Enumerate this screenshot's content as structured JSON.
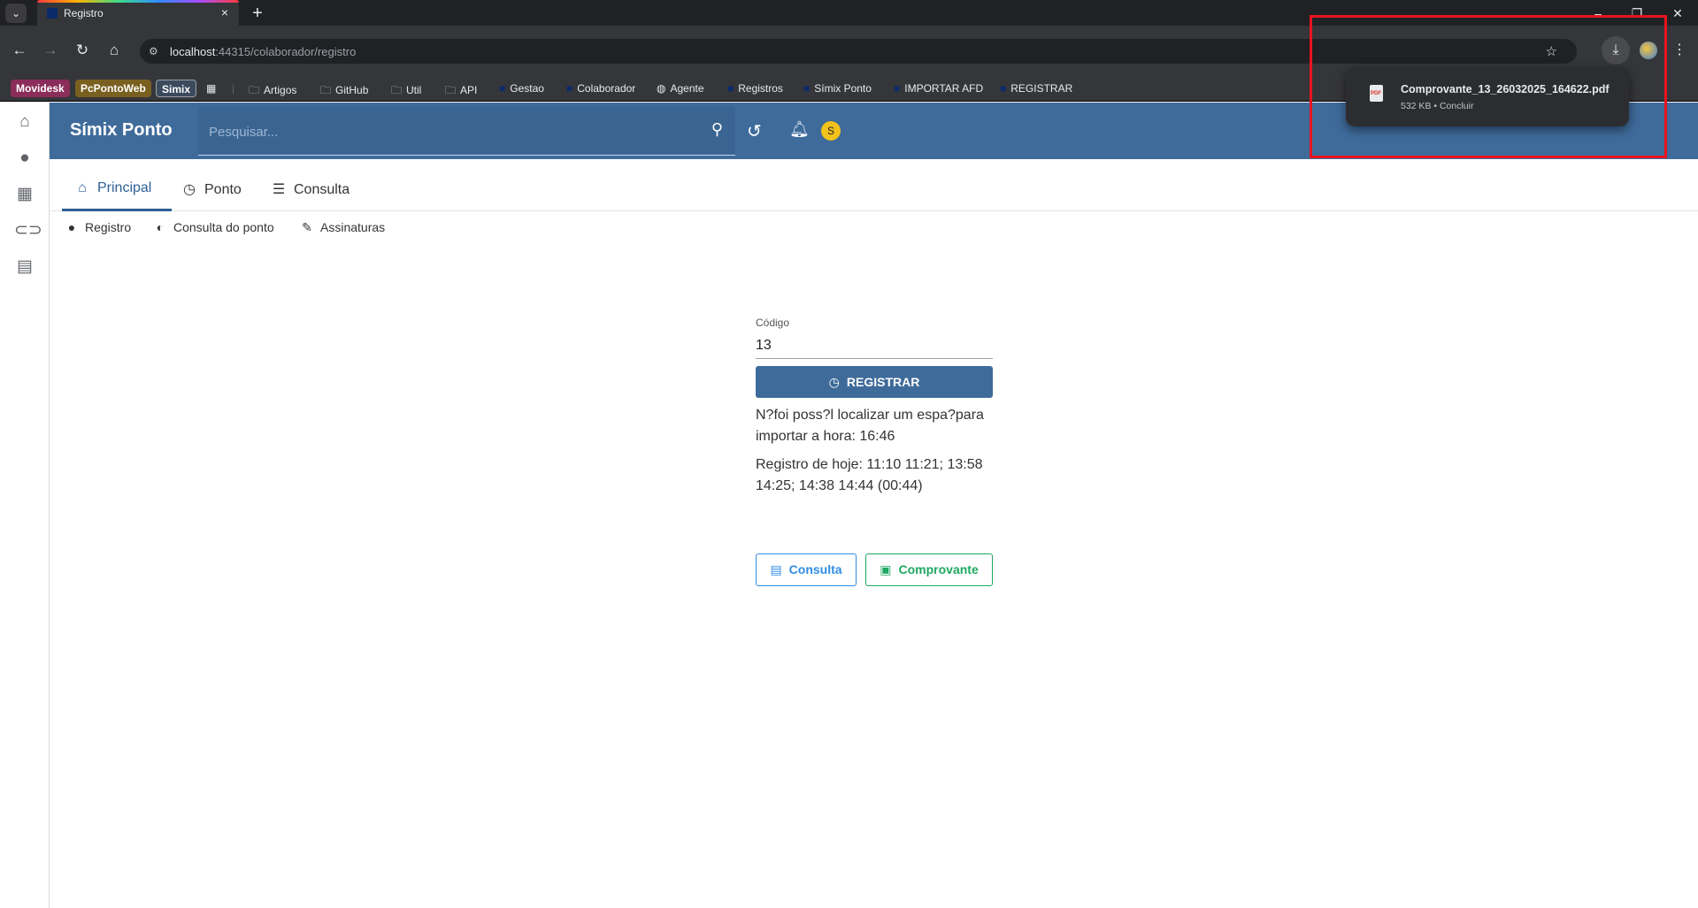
{
  "browser": {
    "tab_title": "Registro",
    "url_host": "localhost",
    "url_path": ":44315/colaborador/registro",
    "bookmarks": [
      {
        "label": "Movidesk",
        "kind": "chip",
        "color": "#c2185b"
      },
      {
        "label": "PcPontoWeb",
        "kind": "chip",
        "color": "#b8860b"
      },
      {
        "label": "Simix",
        "kind": "chip",
        "color": "#3c4a5e"
      },
      {
        "label": "Artigos",
        "kind": "folder"
      },
      {
        "label": "GitHub",
        "kind": "folder"
      },
      {
        "label": "Util",
        "kind": "folder"
      },
      {
        "label": "API",
        "kind": "folder"
      },
      {
        "label": "Gestao",
        "kind": "link"
      },
      {
        "label": "Colaborador",
        "kind": "link"
      },
      {
        "label": "Agente",
        "kind": "link"
      },
      {
        "label": "Registros",
        "kind": "link"
      },
      {
        "label": "Símix Ponto",
        "kind": "link"
      },
      {
        "label": "IMPORTAR AFD",
        "kind": "link"
      },
      {
        "label": "REGISTRAR",
        "kind": "link"
      }
    ]
  },
  "download": {
    "filename": "Comprovante_13_26032025_164622.pdf",
    "status": "532 KB • Concluir"
  },
  "app": {
    "title": "Símix Ponto",
    "search_placeholder": "Pesquisar...",
    "avatar_letter": "S"
  },
  "tabs": {
    "principal": "Principal",
    "ponto": "Ponto",
    "consulta": "Consulta"
  },
  "subnav": {
    "registro": "Registro",
    "consulta_ponto": "Consulta do ponto",
    "assinaturas": "Assinaturas"
  },
  "form": {
    "codigo_label": "Código",
    "codigo_value": "13",
    "registrar_label": "REGISTRAR",
    "message": "N?foi poss?l localizar um espa?para importar a hora: 16:46",
    "today": "Registro de hoje: 11:10 11:21; 13:58 14:25; 14:38 14:44 (00:44)",
    "consulta_label": "Consulta",
    "comprovante_label": "Comprovante"
  },
  "colors": {
    "header": "#3f6b9b",
    "accent": "#2d5f96",
    "consulta": "#2f8de4",
    "comprovante": "#1ea760",
    "highlight": "#e8141f"
  }
}
